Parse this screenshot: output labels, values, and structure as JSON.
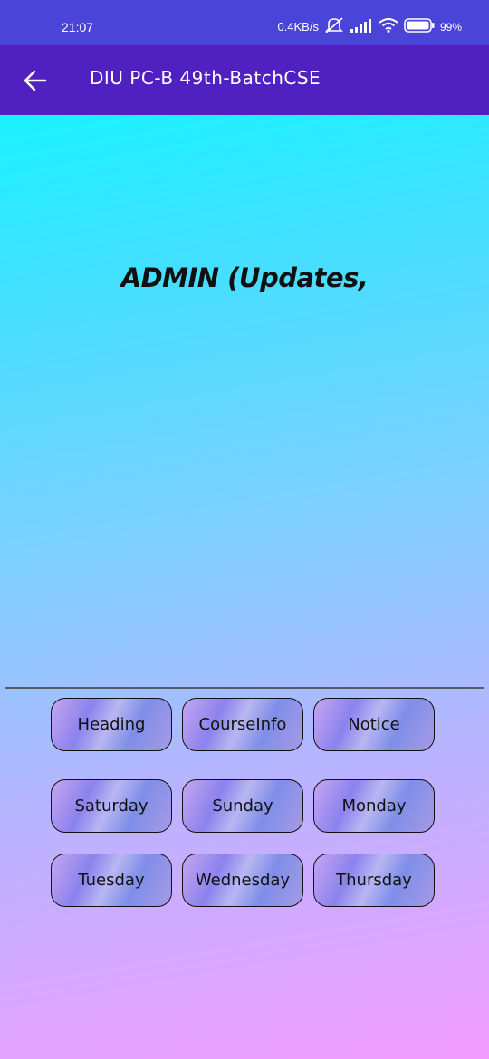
{
  "status_bar": {
    "time": "21:07",
    "network_speed": "0.4KB/s",
    "battery": "99%",
    "icons": [
      "mute-icon",
      "signal-icon",
      "wifi-icon",
      "battery-icon"
    ]
  },
  "app_bar": {
    "title": "DIU PC-B 49th-BatchCSE",
    "back_icon": "arrow-left-icon"
  },
  "main": {
    "headline": "ADMIN (Updates,"
  },
  "buttons": [
    {
      "label": "Heading"
    },
    {
      "label": "CourseInfo"
    },
    {
      "label": "Notice"
    },
    {
      "label": "Saturday"
    },
    {
      "label": "Sunday"
    },
    {
      "label": "Monday"
    },
    {
      "label": "Tuesday"
    },
    {
      "label": "Wednesday"
    },
    {
      "label": "Thursday"
    }
  ],
  "colors": {
    "status_bar": "#4b44d8",
    "app_bar": "#5020c0",
    "gradient_top": "#00ffff",
    "gradient_bottom": "#f29cff"
  }
}
